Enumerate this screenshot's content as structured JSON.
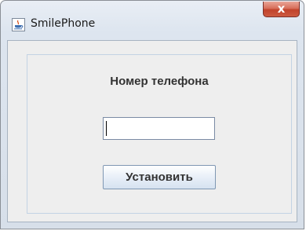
{
  "window": {
    "title": "SmilePhone",
    "app_icon": "java-cup-icon",
    "close_symbol": "x"
  },
  "form": {
    "phone_label": "Номер телефона",
    "phone_value": "",
    "set_button_label": "Установить"
  },
  "colors": {
    "close_button": "#c1432c",
    "client_background": "#eeeeee",
    "panel_border": "#c3d3e4"
  }
}
